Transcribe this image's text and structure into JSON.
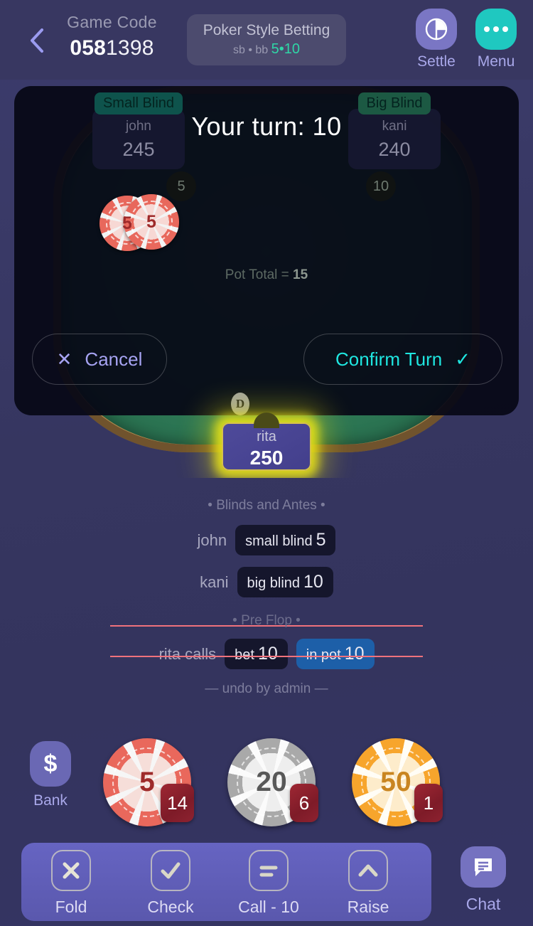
{
  "header": {
    "back_icon": "chevron-left-icon",
    "game_code_label": "Game Code",
    "game_code_bold": "058",
    "game_code_rest": "1398",
    "style_name": "Poker Style Betting",
    "blinds_label": "sb • bb",
    "small_blind": "5",
    "blind_sep": "•",
    "big_blind": "10",
    "settle_label": "Settle",
    "settle_icon": "pie-chart-icon",
    "menu_label": "Menu",
    "menu_icon": "ellipsis-icon",
    "settle_color": "#7a76c4",
    "menu_color": "#1fc8c0",
    "accent_green": "#2fd6a6"
  },
  "table": {
    "turn_title": "Your turn: 10",
    "pot_label": "Pot Total =",
    "pot_value": "15",
    "cancel_label": "Cancel",
    "cancel_icon": "close-x-icon",
    "confirm_label": "Confirm Turn",
    "confirm_icon": "check-icon",
    "dealer_mark": "D",
    "seats": [
      {
        "badge": "Small Blind",
        "name": "john",
        "stack": "245",
        "bet": "5"
      },
      {
        "badge": "Big Blind",
        "name": "kani",
        "stack": "240",
        "bet": "10"
      }
    ],
    "felt_chips": [
      {
        "value": "5"
      },
      {
        "value": "5"
      }
    ],
    "active_seat": {
      "name": "rita",
      "stack": "250"
    }
  },
  "log": {
    "section_blinds": "• Blinds and Antes •",
    "rows": [
      {
        "actor": "john",
        "action": "small blind",
        "amount": "5"
      },
      {
        "actor": "kani",
        "action": "big blind",
        "amount": "10"
      }
    ],
    "section_preflop": "• Pre Flop •",
    "action_row": {
      "actor": "rita calls",
      "bet_label": "bet",
      "bet_amount": "10",
      "pot_label": "in pot",
      "pot_amount": "10"
    },
    "undo_note": "— undo by admin —"
  },
  "tray": {
    "bank_label": "Bank",
    "bank_icon": "dollar-icon",
    "chips": [
      {
        "value": "5",
        "count": "14"
      },
      {
        "value": "20",
        "count": "6"
      },
      {
        "value": "50",
        "count": "1"
      }
    ]
  },
  "actions": {
    "buttons": [
      {
        "label": "Fold",
        "icon": "x-icon"
      },
      {
        "label": "Check",
        "icon": "check-icon"
      },
      {
        "label": "Call - 10",
        "icon": "equals-icon"
      },
      {
        "label": "Raise",
        "icon": "chevron-up-icon"
      }
    ],
    "chat_label": "Chat",
    "chat_icon": "chat-bubble-icon"
  }
}
